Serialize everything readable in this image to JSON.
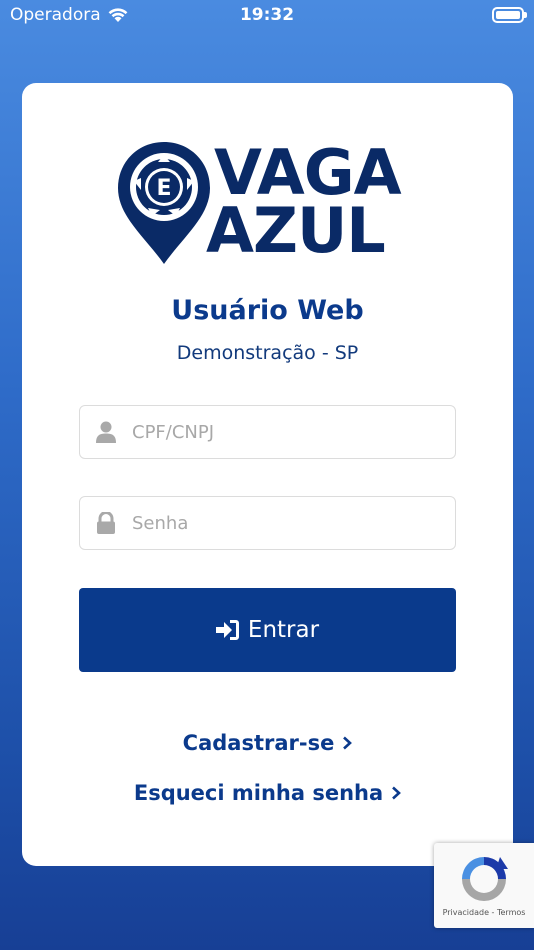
{
  "status_bar": {
    "carrier": "Operadora",
    "time": "19:32"
  },
  "logo": {
    "line1": "VAGA",
    "line2": "AZUL",
    "badge_letter": "E"
  },
  "header": {
    "title": "Usuário Web",
    "subtitle": "Demonstração - SP"
  },
  "form": {
    "user_placeholder": "CPF/CNPJ",
    "user_value": "",
    "password_placeholder": "Senha",
    "password_value": "",
    "submit_label": "Entrar"
  },
  "links": {
    "register": "Cadastrar-se",
    "forgot": "Esqueci minha senha"
  },
  "recaptcha": {
    "privacy": "Privacidade",
    "separator": "-",
    "terms": "Termos"
  },
  "colors": {
    "primary": "#0a3a8c",
    "background_top": "#4a8be0",
    "background_bottom": "#173f95",
    "card": "#ffffff",
    "placeholder": "#a8a8a8"
  },
  "icons": {
    "user": "user-icon",
    "password": "lock-icon",
    "submit": "sign-in-icon",
    "chevron": "chevron-right-icon"
  }
}
